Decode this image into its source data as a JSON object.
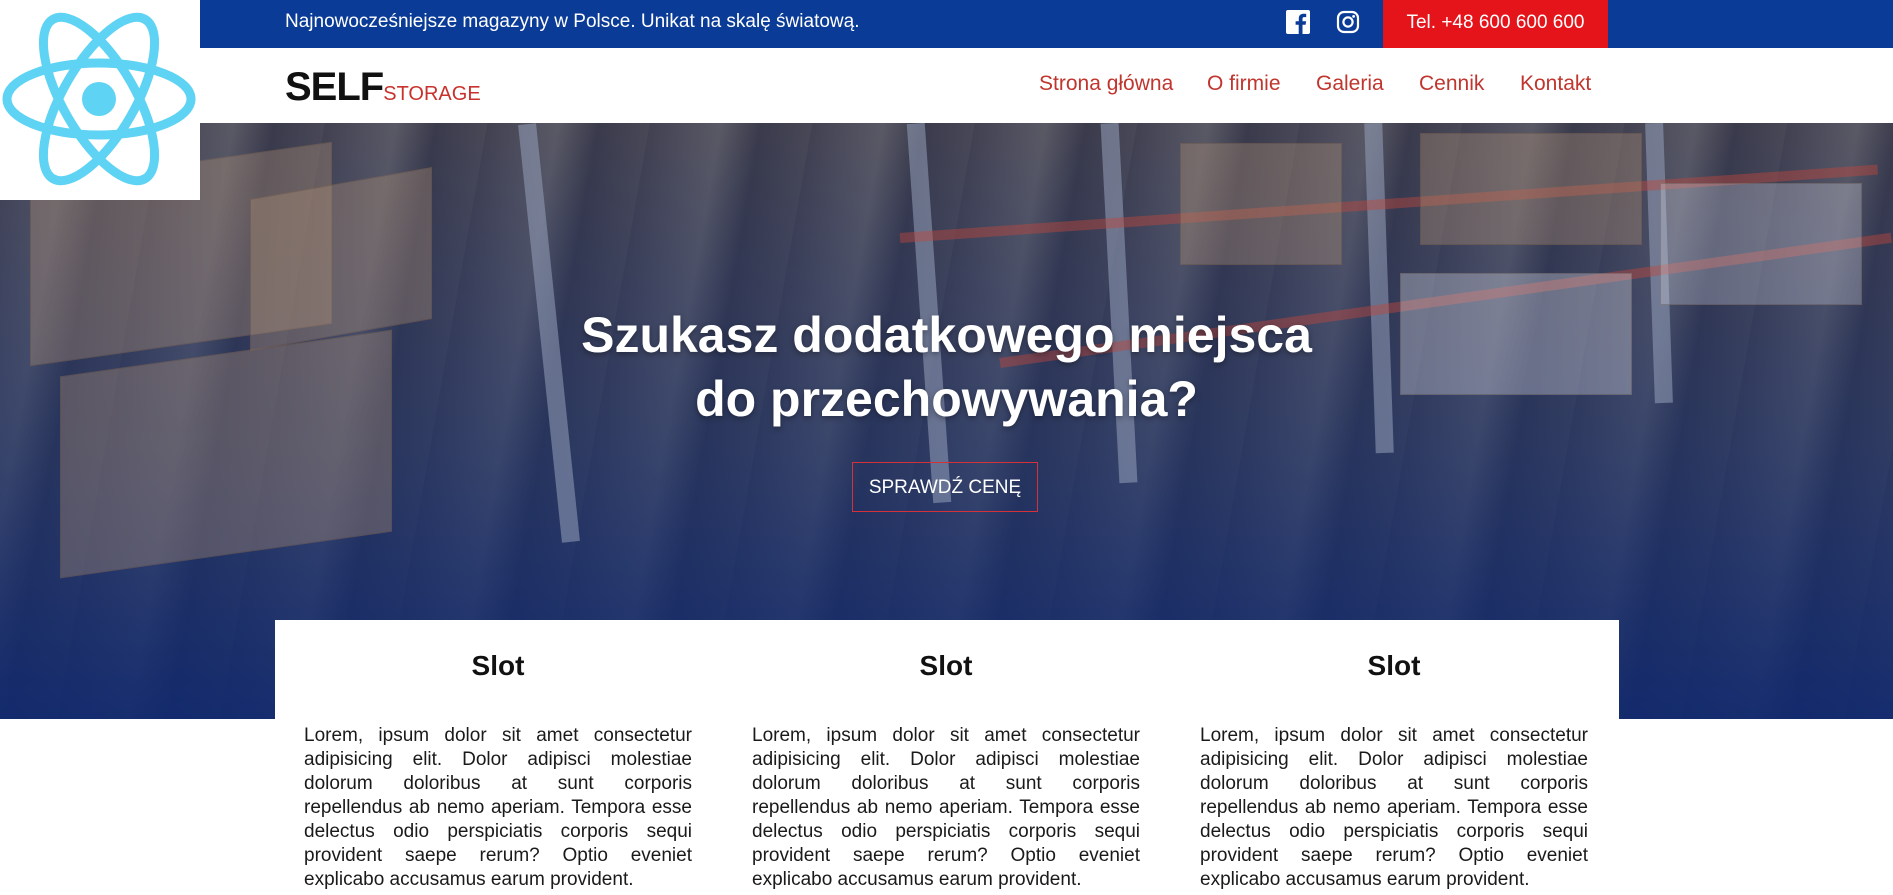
{
  "topbar": {
    "tagline": "Najnowocześniejsze magazyny w Polsce. Unikat na skalę światową.",
    "facebook_icon": "facebook-icon",
    "instagram_icon": "instagram-icon",
    "phone": "Tel. +48 600 600 600",
    "background_color": "#0a3b96",
    "phone_background_color": "#e5141a"
  },
  "logo": {
    "main": "SELF",
    "sub": "STORAGE",
    "react_icon": "react-atom-icon"
  },
  "nav": {
    "items": [
      {
        "label": "Strona główna"
      },
      {
        "label": "O firmie"
      },
      {
        "label": "Galeria"
      },
      {
        "label": "Cennik"
      },
      {
        "label": "Kontakt"
      }
    ],
    "link_color": "#c0352d"
  },
  "hero": {
    "title_line1": "Szukasz dodatkowego miejsca",
    "title_line2": "do przechowywania?",
    "cta_label": "SPRAWDŹ CENĘ",
    "cta_border_color": "#d6303a"
  },
  "cards": [
    {
      "title": "Slot",
      "text": "Lorem, ipsum dolor sit amet consectetur adipisicing elit. Dolor adipisci molestiae dolorum doloribus at sunt corporis repellendus ab nemo aperiam. Tempora esse delectus odio perspiciatis corporis sequi provident saepe rerum? Optio eveniet explicabo accusamus earum provident."
    },
    {
      "title": "Slot",
      "text": "Lorem, ipsum dolor sit amet consectetur adipisicing elit. Dolor adipisci molestiae dolorum doloribus at sunt corporis repellendus ab nemo aperiam. Tempora esse delectus odio perspiciatis corporis sequi provident saepe rerum? Optio eveniet explicabo accusamus earum provident."
    },
    {
      "title": "Slot",
      "text": "Lorem, ipsum dolor sit amet consectetur adipisicing elit. Dolor adipisci molestiae dolorum doloribus at sunt corporis repellendus ab nemo aperiam. Tempora esse delectus odio perspiciatis corporis sequi provident saepe rerum? Optio eveniet explicabo accusamus earum provident."
    }
  ]
}
